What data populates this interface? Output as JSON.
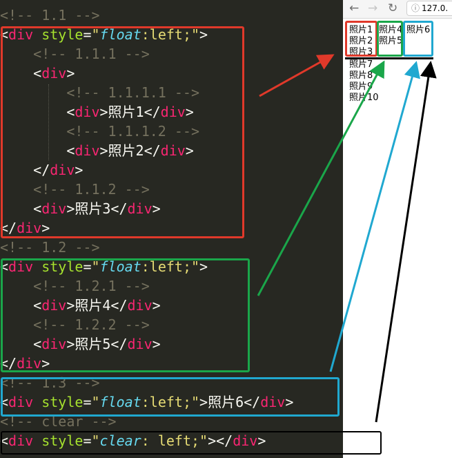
{
  "editor": {
    "lines": [
      {
        "id": "l0",
        "parts": [
          {
            "c": "c",
            "t": "<!-- 1.1 -->"
          }
        ]
      },
      {
        "id": "l1",
        "parts": [
          {
            "c": "p",
            "t": "<"
          },
          {
            "c": "t",
            "t": "div"
          },
          {
            "c": "p",
            "t": " "
          },
          {
            "c": "a",
            "t": "style"
          },
          {
            "c": "p",
            "t": "="
          },
          {
            "c": "s",
            "t": "\""
          },
          {
            "c": "v",
            "t": "float"
          },
          {
            "c": "s",
            "t": ":left;\""
          },
          {
            "c": "p",
            "t": ">"
          }
        ]
      },
      {
        "id": "l2",
        "parts": [
          {
            "c": "c",
            "t": "    <!-- 1.1.1 -->"
          }
        ]
      },
      {
        "id": "l3",
        "parts": [
          {
            "c": "p",
            "t": "    <"
          },
          {
            "c": "t",
            "t": "div"
          },
          {
            "c": "p",
            "t": ">"
          }
        ]
      },
      {
        "id": "l4",
        "parts": [
          {
            "c": "c",
            "t": "        <!-- 1.1.1.1 -->"
          }
        ]
      },
      {
        "id": "l5",
        "parts": [
          {
            "c": "p",
            "t": "        <"
          },
          {
            "c": "t",
            "t": "div"
          },
          {
            "c": "p",
            "t": ">照片1</"
          },
          {
            "c": "t",
            "t": "div"
          },
          {
            "c": "p",
            "t": ">"
          }
        ]
      },
      {
        "id": "l6",
        "parts": [
          {
            "c": "c",
            "t": "        <!-- 1.1.1.2 -->"
          }
        ]
      },
      {
        "id": "l7",
        "parts": [
          {
            "c": "p",
            "t": "        <"
          },
          {
            "c": "t",
            "t": "div"
          },
          {
            "c": "p",
            "t": ">照片2</"
          },
          {
            "c": "t",
            "t": "div"
          },
          {
            "c": "p",
            "t": ">"
          }
        ]
      },
      {
        "id": "l8",
        "parts": [
          {
            "c": "p",
            "t": "    </"
          },
          {
            "c": "t",
            "t": "div"
          },
          {
            "c": "p",
            "t": ">"
          }
        ]
      },
      {
        "id": "l9",
        "parts": [
          {
            "c": "c",
            "t": "    <!-- 1.1.2 -->"
          }
        ]
      },
      {
        "id": "l10",
        "parts": [
          {
            "c": "p",
            "t": "    <"
          },
          {
            "c": "t",
            "t": "div"
          },
          {
            "c": "p",
            "t": ">照片3</"
          },
          {
            "c": "t",
            "t": "div"
          },
          {
            "c": "p",
            "t": ">"
          }
        ]
      },
      {
        "id": "l11",
        "parts": [
          {
            "c": "p",
            "t": "</"
          },
          {
            "c": "t",
            "t": "div"
          },
          {
            "c": "p",
            "t": ">"
          }
        ]
      },
      {
        "id": "l12",
        "parts": [
          {
            "c": "c",
            "t": "<!-- 1.2 -->"
          }
        ]
      },
      {
        "id": "l13",
        "parts": [
          {
            "c": "p",
            "t": "<"
          },
          {
            "c": "t",
            "t": "div"
          },
          {
            "c": "p",
            "t": " "
          },
          {
            "c": "a",
            "t": "style"
          },
          {
            "c": "p",
            "t": "="
          },
          {
            "c": "s",
            "t": "\""
          },
          {
            "c": "v",
            "t": "float"
          },
          {
            "c": "s",
            "t": ":left;\""
          },
          {
            "c": "p",
            "t": ">"
          }
        ]
      },
      {
        "id": "l14",
        "parts": [
          {
            "c": "c",
            "t": "    <!-- 1.2.1 -->"
          }
        ]
      },
      {
        "id": "l15",
        "parts": [
          {
            "c": "p",
            "t": "    <"
          },
          {
            "c": "t",
            "t": "div"
          },
          {
            "c": "p",
            "t": ">照片4</"
          },
          {
            "c": "t",
            "t": "div"
          },
          {
            "c": "p",
            "t": ">"
          }
        ]
      },
      {
        "id": "l16",
        "parts": [
          {
            "c": "c",
            "t": "    <!-- 1.2.2 -->"
          }
        ]
      },
      {
        "id": "l17",
        "parts": [
          {
            "c": "p",
            "t": "    <"
          },
          {
            "c": "t",
            "t": "div"
          },
          {
            "c": "p",
            "t": ">照片5</"
          },
          {
            "c": "t",
            "t": "div"
          },
          {
            "c": "p",
            "t": ">"
          }
        ]
      },
      {
        "id": "l18",
        "parts": [
          {
            "c": "p",
            "t": "</"
          },
          {
            "c": "t",
            "t": "div"
          },
          {
            "c": "p",
            "t": ">"
          }
        ]
      },
      {
        "id": "l19",
        "parts": [
          {
            "c": "c",
            "t": "<!-- 1.3 -->"
          }
        ]
      },
      {
        "id": "l20",
        "parts": [
          {
            "c": "p",
            "t": "<"
          },
          {
            "c": "t",
            "t": "div"
          },
          {
            "c": "p",
            "t": " "
          },
          {
            "c": "a",
            "t": "style"
          },
          {
            "c": "p",
            "t": "="
          },
          {
            "c": "s",
            "t": "\""
          },
          {
            "c": "v",
            "t": "float"
          },
          {
            "c": "s",
            "t": ":left;\""
          },
          {
            "c": "p",
            "t": ">照片6</"
          },
          {
            "c": "t",
            "t": "div"
          },
          {
            "c": "p",
            "t": ">"
          }
        ]
      },
      {
        "id": "l21",
        "parts": [
          {
            "c": "c",
            "t": "<!-- clear -->"
          }
        ]
      },
      {
        "id": "l22",
        "parts": [
          {
            "c": "p",
            "t": "<"
          },
          {
            "c": "t",
            "t": "div"
          },
          {
            "c": "p",
            "t": " "
          },
          {
            "c": "a",
            "t": "style"
          },
          {
            "c": "p",
            "t": "="
          },
          {
            "c": "s",
            "t": "\""
          },
          {
            "c": "v",
            "t": "clear"
          },
          {
            "c": "s",
            "t": ": left;\""
          },
          {
            "c": "p",
            "t": "></"
          },
          {
            "c": "t",
            "t": "div"
          },
          {
            "c": "p",
            "t": ">"
          }
        ]
      }
    ]
  },
  "browser": {
    "url": "127.0.",
    "back_glyph": "←",
    "forward_glyph": "→",
    "reload_glyph": "↻",
    "info_glyph": "ⓘ",
    "photos": {
      "p1": "照片1",
      "p2": "照片2",
      "p3": "照片3",
      "p4": "照片4",
      "p5": "照片5",
      "p6": "照片6",
      "p7": "照片7",
      "p8": "照片8",
      "p9": "照片9",
      "p10": "照片10"
    }
  },
  "annotation_colors": {
    "red": "#e0392a",
    "green": "#1aa64a",
    "blue": "#20a8d0",
    "black": "#000000"
  }
}
